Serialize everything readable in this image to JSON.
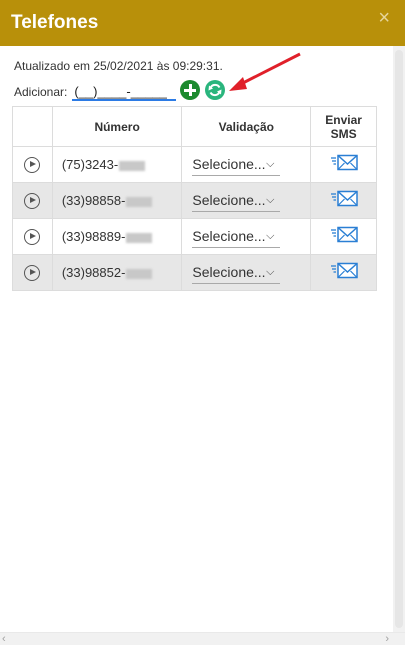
{
  "dialog": {
    "title": "Telefones",
    "close_label": "×"
  },
  "header": {
    "updated_text": "Atualizado em 25/02/2021 às 09:29:31.",
    "add_label": "Adicionar:",
    "phone_input_placeholder": "(__)____-_____"
  },
  "table": {
    "columns": {
      "number": "Número",
      "validation": "Validação",
      "sms_line1": "Enviar",
      "sms_line2": "SMS"
    },
    "rows": [
      {
        "number": "(75)3243-",
        "validation": "Selecione..."
      },
      {
        "number": "(33)98858-",
        "validation": "Selecione..."
      },
      {
        "number": "(33)98889-",
        "validation": "Selecione..."
      },
      {
        "number": "(33)98852-",
        "validation": "Selecione..."
      }
    ]
  },
  "colors": {
    "titlebar": "#b8900a",
    "add_button": "#1c8a2e",
    "refresh_button": "#2ab57d",
    "sms_icon": "#2a7fd4",
    "annotation_arrow": "#e0202a"
  },
  "icons": {
    "close": "close-icon",
    "add": "plus-circle-icon",
    "refresh": "refresh-icon",
    "play": "play-circle-icon",
    "sms": "envelope-icon",
    "dropdown": "chevron-down-icon"
  }
}
